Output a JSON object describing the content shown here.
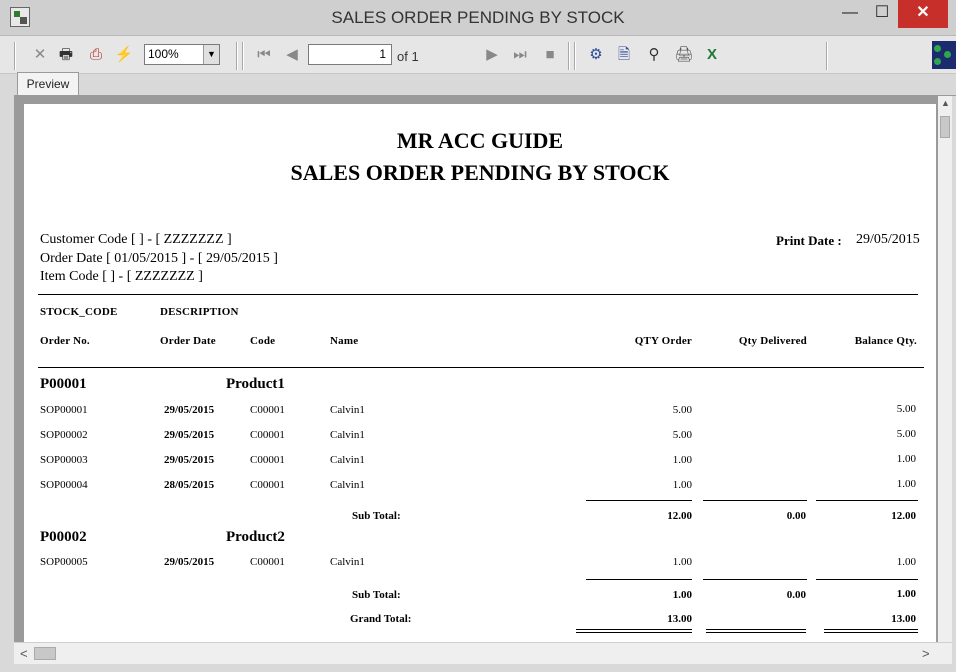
{
  "window": {
    "title": "SALES ORDER PENDING BY STOCK",
    "min": "—",
    "max": "☐",
    "close": "✕"
  },
  "toolbar": {
    "zoom_value": "100%",
    "page_value": "1",
    "page_of": "of 1",
    "icons": [
      "close-icon",
      "print-icon",
      "export-icon",
      "refresh-icon",
      "first-page-icon",
      "prev-page-icon",
      "next-page-icon",
      "last-page-icon",
      "stop-icon",
      "tree-icon",
      "print-setup-icon",
      "search-icon",
      "printer-icon",
      "excel-icon"
    ]
  },
  "tab": {
    "label": "Preview"
  },
  "report": {
    "company": "MR ACC GUIDE",
    "title": "SALES ORDER PENDING BY STOCK",
    "filters": {
      "customer_code": "Customer Code  [  ] - [ ZZZZZZZ ]",
      "order_date": "Order Date [ 01/05/2015 ]  -  [ 29/05/2015 ]",
      "item_code": "Item Code [  ] - [ ZZZZZZZ ]"
    },
    "print_date_label": "Print Date :",
    "print_date": "29/05/2015",
    "columns": {
      "stock_code": "STOCK_CODE",
      "description": "DESCRIPTION",
      "order_no": "Order No.",
      "order_date": "Order Date",
      "code": "Code",
      "name": "Name",
      "qty_order": "QTY Order",
      "qty_delivered": "Qty Delivered",
      "balance_qty": "Balance Qty."
    },
    "groups": [
      {
        "stock_code": "P00001",
        "description": "Product1",
        "rows": [
          {
            "order_no": "SOP00001",
            "order_date": "29/05/2015",
            "code": "C00001",
            "name": "Calvin1",
            "qty_order": "5.00",
            "balance": "5.00"
          },
          {
            "order_no": "SOP00002",
            "order_date": "29/05/2015",
            "code": "C00001",
            "name": "Calvin1",
            "qty_order": "5.00",
            "balance": "5.00"
          },
          {
            "order_no": "SOP00003",
            "order_date": "29/05/2015",
            "code": "C00001",
            "name": "Calvin1",
            "qty_order": "1.00",
            "balance": "1.00"
          },
          {
            "order_no": "SOP00004",
            "order_date": "28/05/2015",
            "code": "C00001",
            "name": "Calvin1",
            "qty_order": "1.00",
            "balance": "1.00"
          }
        ],
        "subtotal": {
          "label": "Sub Total:",
          "qty_order": "12.00",
          "qty_delivered": "0.00",
          "balance": "12.00"
        }
      },
      {
        "stock_code": "P00002",
        "description": "Product2",
        "rows": [
          {
            "order_no": "SOP00005",
            "order_date": "29/05/2015",
            "code": "C00001",
            "name": "Calvin1",
            "qty_order": "1.00",
            "balance": "1.00"
          }
        ],
        "subtotal": {
          "label": "Sub Total:",
          "qty_order": "1.00",
          "qty_delivered": "0.00",
          "balance": "1.00"
        }
      }
    ],
    "grand_total": {
      "label": "Grand Total:",
      "qty_order": "13.00",
      "balance": "13.00"
    }
  }
}
